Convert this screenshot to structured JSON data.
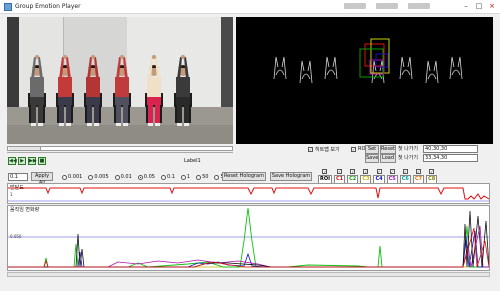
{
  "window": {
    "title": "Group Emotion Player"
  },
  "video": {
    "people": [
      {
        "shirt": "#6b6b6b",
        "pants": "#3a3a3a"
      },
      {
        "shirt": "#c23a3a",
        "pants": "#3a3a48"
      },
      {
        "shirt": "#b33636",
        "pants": "#3a3a48"
      },
      {
        "shirt": "#c03c3c",
        "pants": "#505060"
      },
      {
        "shirt": "#f0e0c8",
        "pants": "#d8244e"
      },
      {
        "shirt": "#3a3a3a",
        "pants": "#2a2a2a"
      }
    ]
  },
  "label": {
    "text": "Label1"
  },
  "controls": {
    "show_hologram_label": "히트맵 보기",
    "roi_label": "ROI",
    "set_label": "Set",
    "reset_label": "Reset",
    "save_label": "Save",
    "load_label": "Load",
    "field1_label": "첫 나가기",
    "field2_label": "첫 나가기",
    "field1_value": "40,30,30",
    "field2_value": "33,34,30",
    "threshold_value": "0.1",
    "apply_label": "Apply All",
    "reset_hologram_label": "Reset Hologram",
    "save_hologram_label": "Save Hologram"
  },
  "radio_options": [
    {
      "label": "0.001",
      "selected": false
    },
    {
      "label": "0.005",
      "selected": false
    },
    {
      "label": "0.01",
      "selected": false
    },
    {
      "label": "0.05",
      "selected": true
    },
    {
      "label": "0.1",
      "selected": false
    },
    {
      "label": "1",
      "selected": false
    },
    {
      "label": "50",
      "selected": false
    },
    {
      "label": "500",
      "selected": false
    }
  ],
  "channels": [
    {
      "label": "ROI",
      "color": "#000000"
    },
    {
      "label": "C1",
      "color": "#e01010"
    },
    {
      "label": "C2",
      "color": "#10a010"
    },
    {
      "label": "C3",
      "color": "#c8b400"
    },
    {
      "label": "C4",
      "color": "#1010c0"
    },
    {
      "label": "C5",
      "color": "#b010b0"
    },
    {
      "label": "C6",
      "color": "#00a0a0"
    },
    {
      "label": "C7",
      "color": "#ff6a00"
    },
    {
      "label": "C8",
      "color": "#808000"
    }
  ],
  "plot1": {
    "title": "발달도",
    "ylabel": "1"
  },
  "plot2": {
    "title": "움직임 변화량",
    "ylabel": "0.050"
  },
  "colors": {
    "accent": "#2a7a2a",
    "plot_red": "#e01010",
    "plot_blue": "#4040d0"
  }
}
